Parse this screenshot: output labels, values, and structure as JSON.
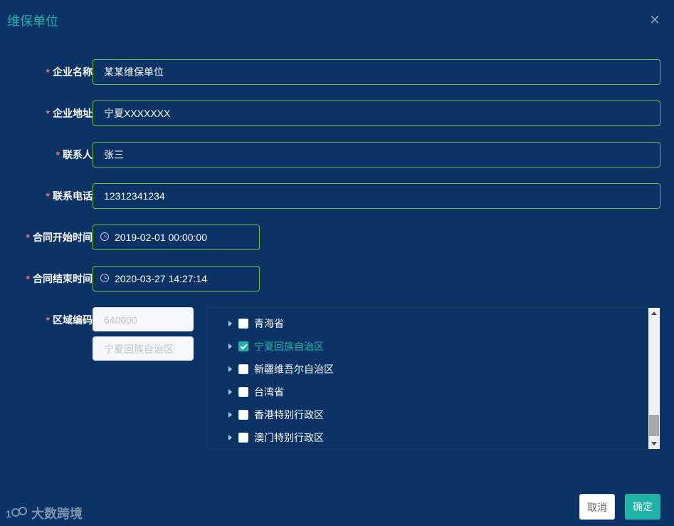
{
  "dialog": {
    "title": "维保单位",
    "close_icon": "close-icon"
  },
  "form": {
    "company_name": {
      "label": "企业名称",
      "required": "*",
      "value": "某某维保单位"
    },
    "company_address": {
      "label": "企业地址",
      "required": "*",
      "value": "宁夏XXXXXXX"
    },
    "contact": {
      "label": "联系人",
      "required": "*",
      "value": "张三"
    },
    "phone": {
      "label": "联系电话",
      "required": "*",
      "value": "12312341234"
    },
    "contract_start": {
      "label": "合同开始时间",
      "required": "*",
      "value": "2019-02-01 00:00:00",
      "icon": "clock-icon"
    },
    "contract_end": {
      "label": "合同结束时间",
      "required": "*",
      "value": "2020-03-27 14:27:14",
      "icon": "clock-icon"
    },
    "region": {
      "label": "区域编码",
      "required": "*",
      "code_placeholder": "640000",
      "name_placeholder": "宁夏回族自治区"
    }
  },
  "tree": {
    "nodes": [
      {
        "label": "青海省",
        "checked": false
      },
      {
        "label": "宁夏回族自治区",
        "checked": true
      },
      {
        "label": "新疆维吾尔自治区",
        "checked": false
      },
      {
        "label": "台湾省",
        "checked": false
      },
      {
        "label": "香港特别行政区",
        "checked": false
      },
      {
        "label": "澳门特别行政区",
        "checked": false
      }
    ]
  },
  "footer": {
    "cancel_label": "取消",
    "confirm_label": "确定"
  },
  "watermark": {
    "text": "大数跨境",
    "logo_text": "1000"
  },
  "colors": {
    "background": "#0b3366",
    "accent": "#1fb3a8",
    "input_border": "#67c23a",
    "required": "#f56c6c"
  }
}
